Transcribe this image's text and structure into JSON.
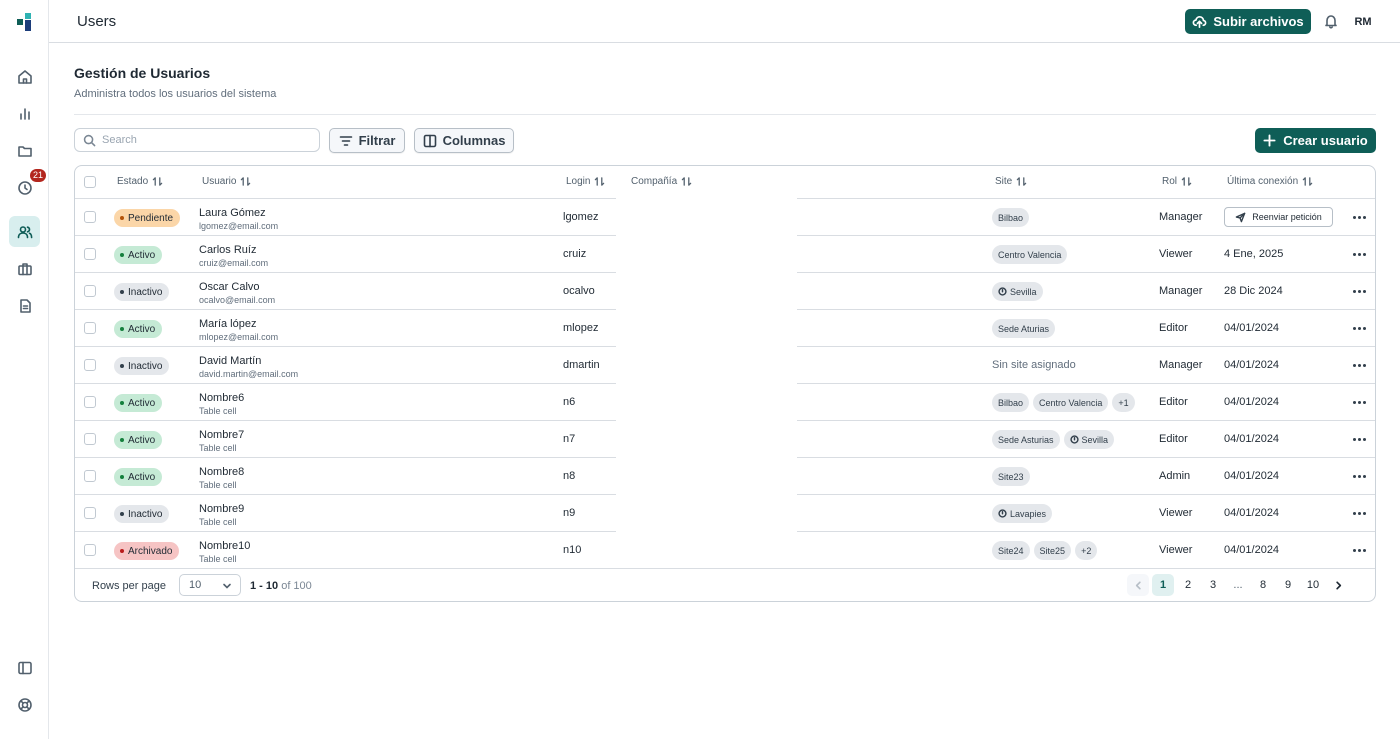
{
  "header": {
    "title": "Users",
    "upload_label": "Subir archivos",
    "avatar_initials": "RM"
  },
  "sidebar": {
    "history_badge": "21",
    "items": [
      "home-icon",
      "chart-icon",
      "folder-icon",
      "clock-icon",
      "users-icon",
      "briefcase-icon",
      "document-icon"
    ],
    "active": "users-icon"
  },
  "page": {
    "title": "Gestión de Usuarios",
    "subtitle": "Administra todos los usuarios del sistema"
  },
  "toolbar": {
    "search_placeholder": "Search",
    "filter_label": "Filtrar",
    "columns_label": "Columnas",
    "create_label": "Crear usuario"
  },
  "table": {
    "columns": {
      "estado": "Estado",
      "usuario": "Usuario",
      "login": "Login",
      "compania": "Compañía",
      "site": "Site",
      "rol": "Rol",
      "ultima": "Última conexión"
    },
    "rows": [
      {
        "status": "Pendiente",
        "status_type": "pending",
        "name": "Laura Gómez",
        "email": "lgomez@email.com",
        "login": "lgomez",
        "sites": [
          {
            "label": "Bilbao",
            "icon": false
          }
        ],
        "role": "Manager",
        "last": "",
        "action": "Reenviar petición"
      },
      {
        "status": "Activo",
        "status_type": "active",
        "name": "Carlos Ruíz",
        "email": "cruiz@email.com",
        "login": "cruiz",
        "sites": [
          {
            "label": "Centro Valencia",
            "icon": false
          }
        ],
        "role": "Viewer",
        "last": "4 Ene, 2025"
      },
      {
        "status": "Inactivo",
        "status_type": "inactive",
        "name": "Oscar Calvo",
        "email": "ocalvo@email.com",
        "login": "ocalvo",
        "sites": [
          {
            "label": "Sevilla",
            "icon": true
          }
        ],
        "role": "Manager",
        "last": "28 Dic 2024"
      },
      {
        "status": "Activo",
        "status_type": "active",
        "name": "María lópez",
        "email": "mlopez@email.com",
        "login": "mlopez",
        "sites": [
          {
            "label": "Sede Aturias",
            "icon": false
          }
        ],
        "role": "Editor",
        "last": "04/01/2024"
      },
      {
        "status": "Inactivo",
        "status_type": "inactive",
        "name": "David Martín",
        "email": "david.martin@email.com",
        "login": "dmartin",
        "sites": [],
        "no_site": "Sin site asignado",
        "role": "Manager",
        "last": "04/01/2024"
      },
      {
        "status": "Activo",
        "status_type": "active",
        "name": "Nombre6",
        "email": "Table cell",
        "login": "n6",
        "sites": [
          {
            "label": "Bilbao",
            "icon": false
          },
          {
            "label": "Centro Valencia",
            "icon": false
          },
          {
            "label": "+1",
            "icon": false
          }
        ],
        "role": "Editor",
        "last": "04/01/2024"
      },
      {
        "status": "Activo",
        "status_type": "active",
        "name": "Nombre7",
        "email": "Table cell",
        "login": "n7",
        "sites": [
          {
            "label": "Sede Asturias",
            "icon": false
          },
          {
            "label": "Sevilla",
            "icon": true
          }
        ],
        "role": "Editor",
        "last": "04/01/2024"
      },
      {
        "status": "Activo",
        "status_type": "active",
        "name": "Nombre8",
        "email": "Table cell",
        "login": "n8",
        "sites": [
          {
            "label": "Site23",
            "icon": false
          }
        ],
        "role": "Admin",
        "last": "04/01/2024"
      },
      {
        "status": "Inactivo",
        "status_type": "inactive",
        "name": "Nombre9",
        "email": "Table cell",
        "login": "n9",
        "sites": [
          {
            "label": "Lavapies",
            "icon": true
          }
        ],
        "role": "Viewer",
        "last": "04/01/2024"
      },
      {
        "status": "Archivado",
        "status_type": "archived",
        "name": "Nombre10",
        "email": "Table cell",
        "login": "n10",
        "sites": [
          {
            "label": "Site24",
            "icon": false
          },
          {
            "label": "Site25",
            "icon": false
          },
          {
            "label": "+2",
            "icon": false
          }
        ],
        "role": "Viewer",
        "last": "04/01/2024"
      }
    ]
  },
  "footer": {
    "rows_per_page_label": "Rows per page",
    "rows_per_page_value": "10",
    "range_bold": "1 - 10",
    "range_rest": " of 100",
    "pages": [
      "1",
      "2",
      "3",
      "...",
      "8",
      "9",
      "10"
    ],
    "current_page": "1"
  },
  "colors": {
    "accent": "#0f5e57",
    "pending_bg": "#fbd6a8",
    "pending_dot": "#b45309",
    "active_bg": "#c5ead5",
    "active_dot": "#15803d",
    "inactive_bg": "#e4e7eb",
    "inactive_dot": "#323f4b",
    "archived_bg": "#f6c4c4",
    "archived_dot": "#b91c1c"
  }
}
